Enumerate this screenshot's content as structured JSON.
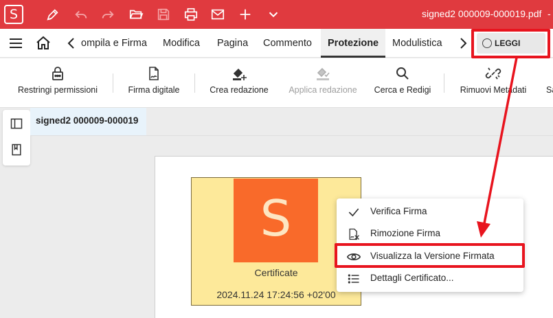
{
  "titlebar": {
    "app_logo": "S",
    "document_title": "signed2 000009-000019.pdf",
    "trailing": "-",
    "icons": [
      "pen-icon",
      "undo-icon",
      "redo-icon",
      "folder-open-icon",
      "save-icon",
      "print-icon",
      "mail-icon",
      "plus-icon",
      "chevron-down-icon"
    ]
  },
  "menubar": {
    "tabs": [
      {
        "label": "ompila e Firma"
      },
      {
        "label": "Modifica"
      },
      {
        "label": "Pagina"
      },
      {
        "label": "Commento"
      },
      {
        "label": "Protezione",
        "active": true
      },
      {
        "label": "Modulistica"
      }
    ],
    "read_mode_label": "LEGGI"
  },
  "ribbon": {
    "buttons": [
      {
        "label": "Restringi permissioni",
        "icon": "lock-icon",
        "enabled": true
      },
      {
        "label": "Firma digitale",
        "icon": "file-signature-icon",
        "enabled": true
      },
      {
        "label": "Crea redazione",
        "icon": "redact-add-icon",
        "enabled": true
      },
      {
        "label": "Applica redazione",
        "icon": "redact-apply-icon",
        "enabled": false
      },
      {
        "label": "Cerca e Redigi",
        "icon": "search-icon",
        "enabled": true
      },
      {
        "label": "Rimuovi Metadati",
        "icon": "unlink-icon",
        "enabled": true
      },
      {
        "label": "Sa",
        "icon": "",
        "enabled": true
      }
    ]
  },
  "document": {
    "tab_label": "signed2 000009-000019"
  },
  "stamp": {
    "logo_letter": "S",
    "caption": "Certificate",
    "date": "2024.11.24 17:24:56 +02'00"
  },
  "context_menu": {
    "items": [
      {
        "label": "Verifica Firma",
        "icon": "check-icon"
      },
      {
        "label": "Rimozione Firma",
        "icon": "remove-signature-icon"
      },
      {
        "label": "Visualizza la Versione Firmata",
        "icon": "eye-icon",
        "highlighted": true
      },
      {
        "label": "Dettagli Certificato...",
        "icon": "list-icon"
      }
    ]
  },
  "colors": {
    "titlebar": "#e03a3f",
    "highlight": "#e8141e",
    "stamp_bg": "#fde99a",
    "stamp_logo": "#f96a2a"
  }
}
